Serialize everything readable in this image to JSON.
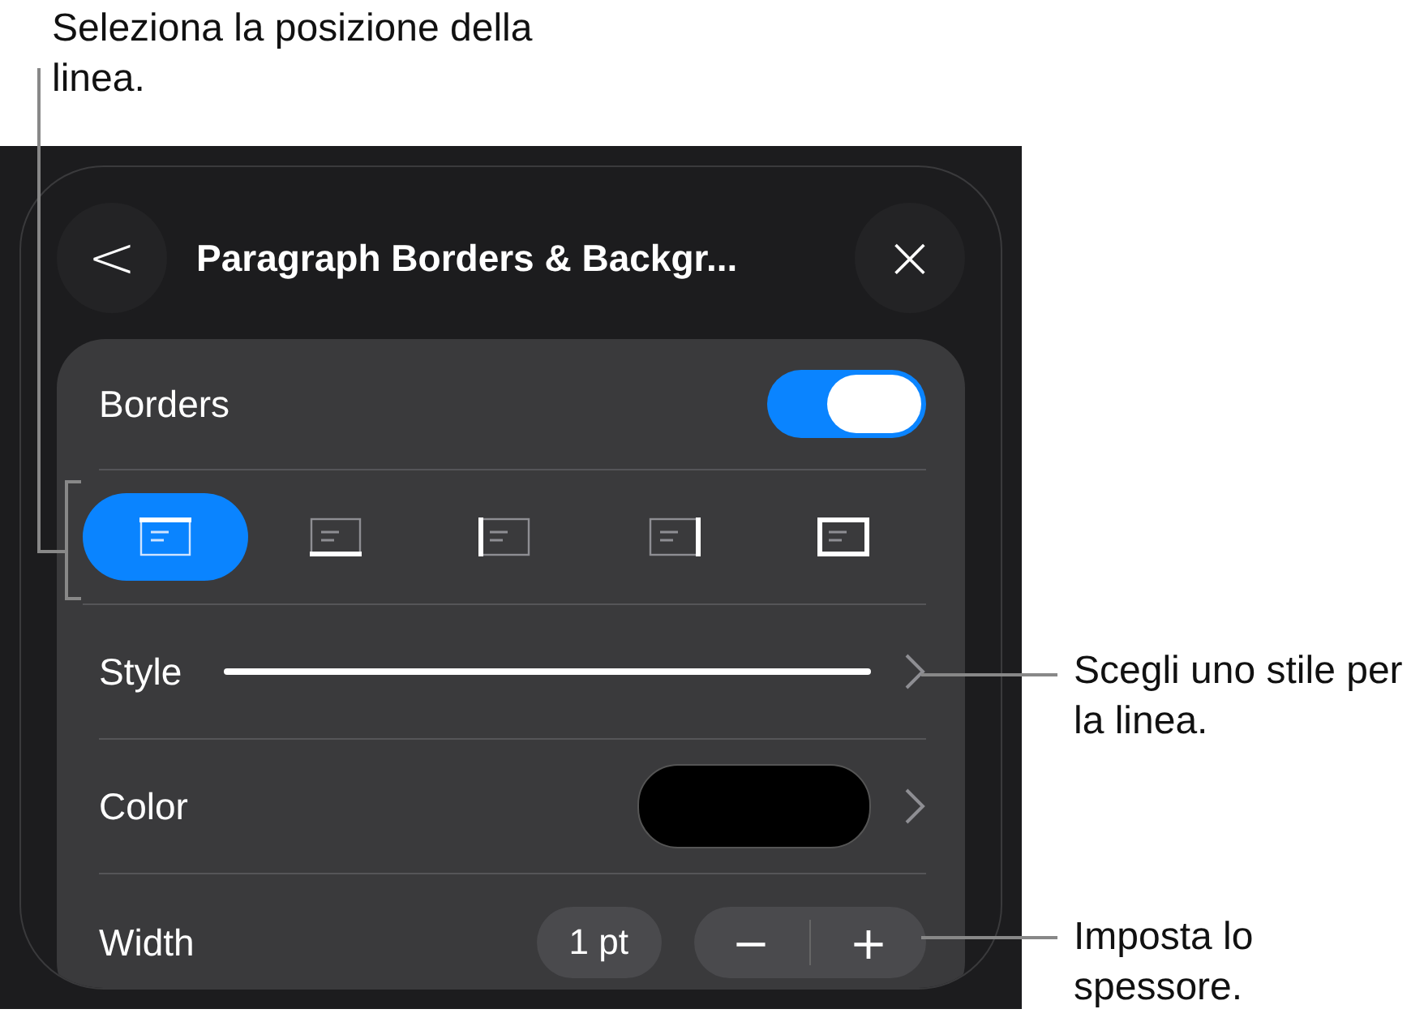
{
  "callouts": [
    {
      "text": "Seleziona la posizione della linea."
    },
    {
      "text": "Scegli uno stile per la linea."
    },
    {
      "text": "Imposta lo spessore."
    }
  ],
  "header": {
    "back": "<",
    "title": "Paragraph Borders & Backgr...",
    "close": "×"
  },
  "borders": {
    "label": "Borders",
    "on": true
  },
  "positions": [
    {
      "kind": "top",
      "selected": true
    },
    {
      "kind": "bottom",
      "selected": false
    },
    {
      "kind": "left",
      "selected": false
    },
    {
      "kind": "right",
      "selected": false
    },
    {
      "kind": "box",
      "selected": false
    }
  ],
  "style": {
    "label": "Style"
  },
  "color": {
    "label": "Color"
  },
  "width": {
    "label": "Width",
    "value": "1 pt",
    "minus": "−",
    "plus": "+"
  }
}
